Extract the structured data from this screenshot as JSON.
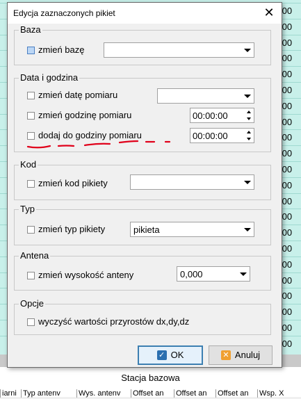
{
  "dialog": {
    "title": "Edycja zaznaczonych pikiet",
    "close_glyph": "✕"
  },
  "groups": {
    "baza": {
      "legend": "Baza",
      "change_base_label": "zmień bazę",
      "base_value": ""
    },
    "data": {
      "legend": "Data i godzina",
      "change_date_label": "zmień datę pomiaru",
      "date_value": "",
      "change_time_label": "zmień godzinę pomiaru",
      "time_value": "00:00:00",
      "add_time_label": "dodaj do godziny pomiaru",
      "add_time_value": "00:00:00"
    },
    "kod": {
      "legend": "Kod",
      "change_code_label": "zmień kod pikiety",
      "code_value": ""
    },
    "typ": {
      "legend": "Typ",
      "change_type_label": "zmień typ pikiety",
      "type_value": "pikieta"
    },
    "antena": {
      "legend": "Antena",
      "change_height_label": "zmień wysokość anteny",
      "height_value": "0,000"
    },
    "opcje": {
      "legend": "Opcje",
      "clear_increments_label": "wyczyść wartości przyrostów dx,dy,dz"
    }
  },
  "buttons": {
    "ok_label": "OK",
    "cancel_label": "Anuluj"
  },
  "background": {
    "cell_values": [
      ",00",
      ",00",
      ",00",
      ",00",
      ",00",
      ",00",
      ",00",
      ",00",
      ",00",
      ",00",
      ",00",
      ",00",
      ",00",
      ",00",
      ",00",
      ",00",
      ",00",
      ",00",
      ",00",
      ",00",
      ",00",
      ",00"
    ],
    "footer_label": "Stacja bazowa",
    "column_headers": [
      "iarni",
      "Typ antenv",
      "Wys. antenv",
      "Offset an",
      "Offset an",
      "Offset an",
      "Wsp. X"
    ]
  },
  "colors": {
    "accent": "#3c7fb1",
    "grid_bg": "#c8f0ea",
    "annotation": "#e0001a"
  }
}
